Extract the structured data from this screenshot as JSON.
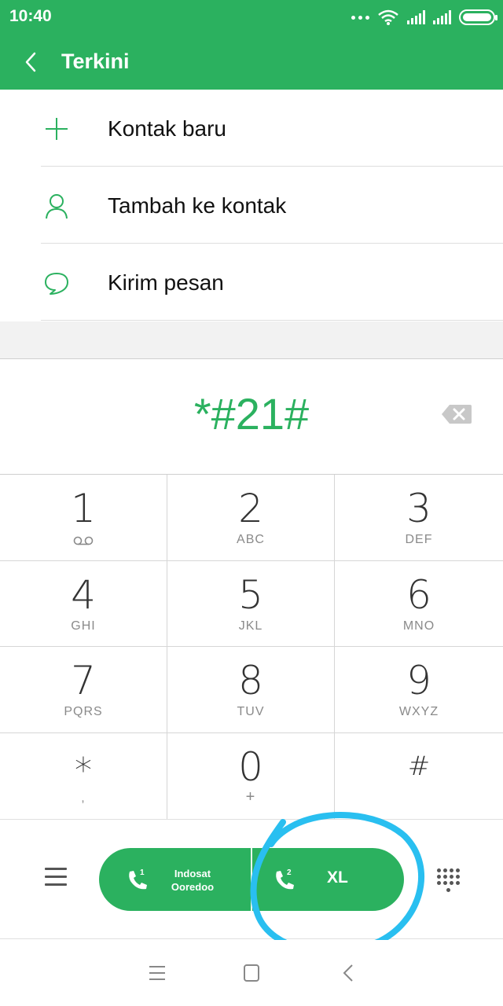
{
  "status_bar": {
    "time": "10:40",
    "icons": [
      "more-dots-icon",
      "wifi-icon",
      "signal-sim1-icon",
      "signal-sim2-icon",
      "battery-icon"
    ]
  },
  "header": {
    "title": "Terkini",
    "back_icon": "back-arrow-icon"
  },
  "options": [
    {
      "label": "Kontak baru",
      "icon": "plus-icon"
    },
    {
      "label": "Tambah ke kontak",
      "icon": "person-icon"
    },
    {
      "label": "Kirim pesan",
      "icon": "message-icon"
    }
  ],
  "dialer": {
    "number": "*#21#"
  },
  "keypad": [
    {
      "digit": "1",
      "letters": ""
    },
    {
      "digit": "2",
      "letters": "ABC"
    },
    {
      "digit": "3",
      "letters": "DEF"
    },
    {
      "digit": "4",
      "letters": "GHI"
    },
    {
      "digit": "5",
      "letters": "JKL"
    },
    {
      "digit": "6",
      "letters": "MNO"
    },
    {
      "digit": "7",
      "letters": "PQRS"
    },
    {
      "digit": "8",
      "letters": "TUV"
    },
    {
      "digit": "9",
      "letters": "WXYZ"
    },
    {
      "digit": "*",
      "letters": ","
    },
    {
      "digit": "0",
      "letters": "+"
    },
    {
      "digit": "#",
      "letters": ""
    }
  ],
  "call_buttons": {
    "sim1": {
      "badge": "1",
      "label_line1": "Indosat",
      "label_line2": "Ooredoo"
    },
    "sim2": {
      "badge": "2",
      "label": "XL"
    }
  },
  "colors": {
    "accent": "#2bb15f",
    "annotation": "#29bff0",
    "text": "#111111"
  },
  "navbar": {
    "icons": [
      "recent-apps-icon",
      "home-icon",
      "back-icon"
    ]
  }
}
